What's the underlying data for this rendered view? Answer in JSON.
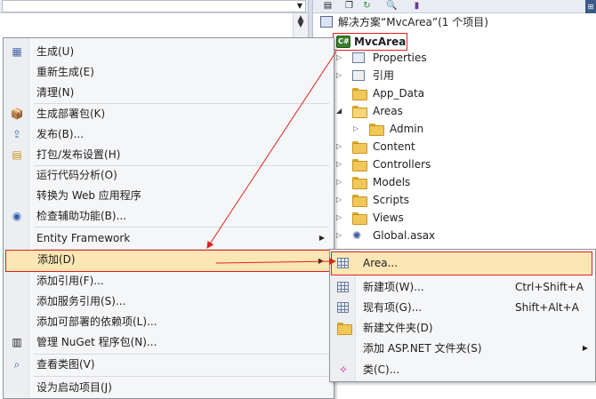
{
  "colors": {
    "highlight": "#fbe6b4",
    "annotation_red": "#e0201c",
    "folder": "#f1c75a"
  },
  "solution_explorer": {
    "solution_label": "解决方案“MvcArea”(1 个项目)",
    "project_label": "MvcArea",
    "nodes": [
      {
        "label": "Properties",
        "icon": "properties-icon"
      },
      {
        "label": "引用",
        "icon": "references-icon"
      },
      {
        "label": "App_Data",
        "icon": "folder-icon"
      },
      {
        "label": "Areas",
        "icon": "open-folder-icon"
      },
      {
        "label": "Admin",
        "icon": "folder-icon"
      },
      {
        "label": "Content",
        "icon": "folder-icon"
      },
      {
        "label": "Controllers",
        "icon": "folder-icon"
      },
      {
        "label": "Models",
        "icon": "folder-icon"
      },
      {
        "label": "Scripts",
        "icon": "folder-icon"
      },
      {
        "label": "Views",
        "icon": "folder-icon"
      },
      {
        "label": "Global.asax",
        "icon": "global-asax-icon"
      }
    ]
  },
  "context_menu": {
    "items": [
      {
        "label": "生成(U)"
      },
      {
        "label": "重新生成(E)"
      },
      {
        "label": "清理(N)"
      },
      {
        "label": "生成部署包(K)"
      },
      {
        "label": "发布(B)..."
      },
      {
        "label": "打包/发布设置(H)"
      },
      {
        "label": "运行代码分析(O)"
      },
      {
        "label": "转换为 Web 应用程序"
      },
      {
        "label": "检查辅助功能(B)..."
      },
      {
        "label": "Entity Framework"
      },
      {
        "label": "添加(D)"
      },
      {
        "label": "添加引用(F)..."
      },
      {
        "label": "添加服务引用(S)..."
      },
      {
        "label": "添加可部署的依赖项(L)..."
      },
      {
        "label": "管理 NuGet 程序包(N)..."
      },
      {
        "label": "查看类图(V)"
      },
      {
        "label": "设为启动项目(J)"
      }
    ]
  },
  "submenu": {
    "items": [
      {
        "label": "Area...",
        "shortcut": ""
      },
      {
        "label": "新建项(W)...",
        "shortcut": "Ctrl+Shift+A"
      },
      {
        "label": "现有项(G)...",
        "shortcut": "Shift+Alt+A"
      },
      {
        "label": "新建文件夹(D)",
        "shortcut": ""
      },
      {
        "label": "添加 ASP.NET 文件夹(S)",
        "shortcut": ""
      },
      {
        "label": "类(C)...",
        "shortcut": ""
      }
    ]
  }
}
